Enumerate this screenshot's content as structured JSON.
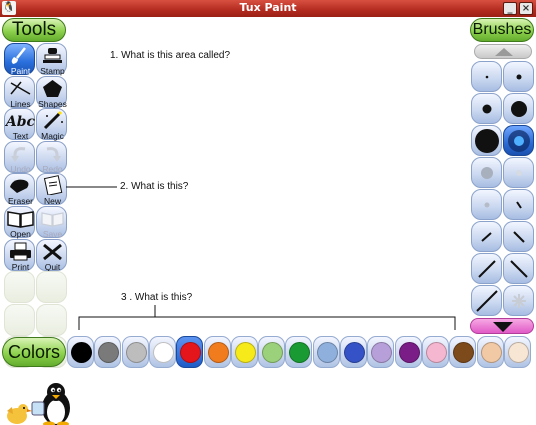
{
  "window": {
    "title": "Tux Paint",
    "buttons": [
      "_",
      "×"
    ]
  },
  "tools_header": "Tools",
  "tools": [
    {
      "label": "Paint",
      "icon": "paint-brush-icon",
      "state": "active"
    },
    {
      "label": "Stamp",
      "icon": "stamp-icon",
      "state": "normal"
    },
    {
      "label": "Lines",
      "icon": "lines-icon",
      "state": "normal"
    },
    {
      "label": "Shapes",
      "icon": "shapes-icon",
      "state": "normal"
    },
    {
      "label": "Text",
      "icon": "text-icon",
      "state": "normal"
    },
    {
      "label": "Magic",
      "icon": "magic-wand-icon",
      "state": "normal"
    },
    {
      "label": "Undo",
      "icon": "undo-icon",
      "state": "disabled"
    },
    {
      "label": "Redo",
      "icon": "redo-icon",
      "state": "disabled"
    },
    {
      "label": "Eraser",
      "icon": "eraser-icon",
      "state": "normal"
    },
    {
      "label": "New",
      "icon": "new-page-icon",
      "state": "normal"
    },
    {
      "label": "Open",
      "icon": "open-book-icon",
      "state": "normal"
    },
    {
      "label": "Save",
      "icon": "save-icon",
      "state": "disabled"
    },
    {
      "label": "Print",
      "icon": "printer-icon",
      "state": "normal"
    },
    {
      "label": "Quit",
      "icon": "quit-icon",
      "state": "normal"
    }
  ],
  "annotations": {
    "q1": "1. What is this area called?",
    "q2": "2. What is this?",
    "q3": "3 . What is this?"
  },
  "brushes_header": "Brushes",
  "brushes": [
    {
      "shape": "dot-tiny"
    },
    {
      "shape": "dot-small"
    },
    {
      "shape": "dot-medium"
    },
    {
      "shape": "dot-large"
    },
    {
      "shape": "dot-xlarge"
    },
    {
      "shape": "dot-fuzzy",
      "selected": true
    },
    {
      "shape": "dot-soft-gray"
    },
    {
      "shape": "dot-soft-faint"
    },
    {
      "shape": "dot-faint-small"
    },
    {
      "shape": "slash-short"
    },
    {
      "shape": "slash-forward"
    },
    {
      "shape": "slash-back"
    },
    {
      "shape": "line-forward"
    },
    {
      "shape": "line-back"
    },
    {
      "shape": "line-forward-long"
    },
    {
      "shape": "splatter"
    }
  ],
  "colors_header": "Colors",
  "colors": [
    {
      "hex": "#000000"
    },
    {
      "hex": "#7a7a7a"
    },
    {
      "hex": "#bdbdbd"
    },
    {
      "hex": "#ffffff"
    },
    {
      "hex": "#e5151c",
      "selected": true
    },
    {
      "hex": "#f07c1e"
    },
    {
      "hex": "#f6ea1b"
    },
    {
      "hex": "#9bd17a"
    },
    {
      "hex": "#1a9a33"
    },
    {
      "hex": "#8fb0dc"
    },
    {
      "hex": "#3553c6"
    },
    {
      "hex": "#b7a0d9"
    },
    {
      "hex": "#7a1d86"
    },
    {
      "hex": "#f5b6cf"
    },
    {
      "hex": "#7d4a1b"
    },
    {
      "hex": "#f1c9a4"
    },
    {
      "hex": "#f7e6d4"
    }
  ]
}
